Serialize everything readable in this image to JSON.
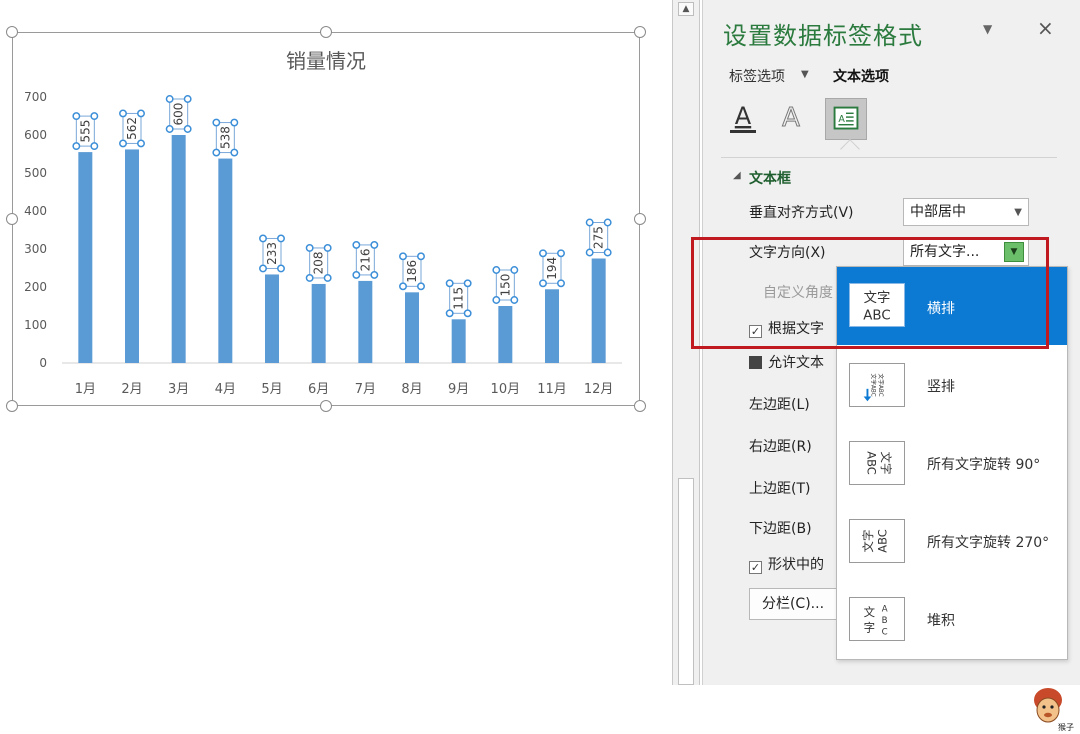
{
  "chart_data": {
    "type": "bar",
    "title": "销量情况",
    "categories": [
      "1月",
      "2月",
      "3月",
      "4月",
      "5月",
      "6月",
      "7月",
      "8月",
      "9月",
      "10月",
      "11月",
      "12月"
    ],
    "values": [
      555,
      562,
      600,
      538,
      233,
      208,
      216,
      186,
      115,
      150,
      194,
      275
    ],
    "data_labels": [
      "555",
      "562",
      "600",
      "538",
      "233",
      "208",
      "216",
      "186",
      "115",
      "150",
      "194",
      "275"
    ],
    "yticks": [
      "0",
      "100",
      "200",
      "300",
      "400",
      "500",
      "600",
      "700"
    ],
    "ylim": [
      0,
      700
    ],
    "grid": false,
    "legend": "none",
    "bar_color": "#5b9bd5",
    "label_orientation": "rotated-270"
  },
  "pane": {
    "title": "设置数据标签格式",
    "dropdown_arrow": "▼",
    "close": "×",
    "tabs": {
      "label_options": "标签选项",
      "label_caret": "▼",
      "text_options": "文本选项"
    },
    "icons": {
      "text_fill": "text-fill-icon",
      "text_outline": "text-outline-icon",
      "textbox": "textbox-icon"
    },
    "section": {
      "caret": "◢",
      "title": "文本框"
    },
    "rows": {
      "vertical_align_label": "垂直对齐方式(V)",
      "vertical_align_value": "中部居中",
      "text_direction_label": "文字方向(X)",
      "text_direction_value": "所有文字...",
      "custom_angle_label": "自定义角度",
      "resize_shape_label": "根据文字",
      "allow_overflow_label": "允许文本",
      "left_margin_label": "左边距(L)",
      "right_margin_label": "右边距(R)",
      "top_margin_label": "上边距(T)",
      "bottom_margin_label": "下边距(B)",
      "wrap_label": "形状中的",
      "columns_button": "分栏(C)..."
    },
    "checks": {
      "resize_shape": "✓",
      "wrap": "✓"
    }
  },
  "dropdown": {
    "items": [
      {
        "label": "横排",
        "icon_top": "文字",
        "icon_bottom": "ABC",
        "selected": true
      },
      {
        "label": "竖排",
        "selected": false
      },
      {
        "label": "所有文字旋转 90°",
        "selected": false
      },
      {
        "label": "所有文字旋转 270°",
        "selected": false
      },
      {
        "label": "堆积",
        "selected": false
      }
    ]
  },
  "colors": {
    "accent_green": "#2b7a3e",
    "selected_blue": "#0c79d3",
    "highlight_red": "#c0191f"
  }
}
